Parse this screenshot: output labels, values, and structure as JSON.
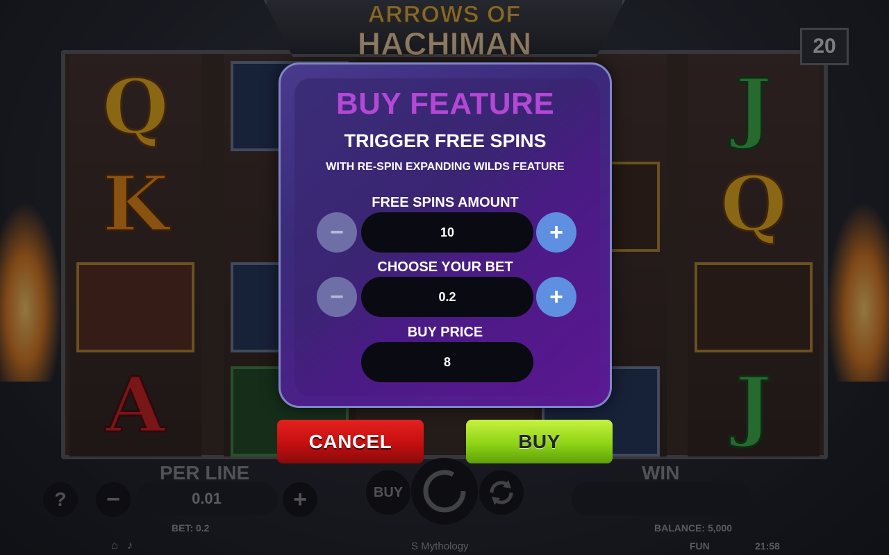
{
  "game": {
    "title_line1": "ARROWS OF",
    "title_line2": "HACHIMAN",
    "lines_count": "20"
  },
  "reels": {
    "col1": [
      "Q",
      "K",
      "",
      "A"
    ],
    "col5": [
      "J",
      "Q",
      "",
      "J"
    ]
  },
  "modal": {
    "title": "BUY FEATURE",
    "subtitle": "TRIGGER FREE SPINS",
    "subtitle2": "WITH RE-SPIN EXPANDING WILDS FEATURE",
    "free_spins_label": "FREE SPINS AMOUNT",
    "free_spins_value": "10",
    "bet_label": "CHOOSE YOUR BET",
    "bet_value": "0.2",
    "price_label": "BUY PRICE",
    "price_value": "8",
    "minus_symbol": "−",
    "plus_symbol": "+"
  },
  "actions": {
    "cancel_label": "CANCEL",
    "buy_label": "BUY"
  },
  "bottom": {
    "per_line_label": "PER LINE",
    "per_line_value": "0.01",
    "win_label": "WIN",
    "help_symbol": "?",
    "minus_symbol": "−",
    "plus_symbol": "+",
    "buy_small_label": "BUY",
    "bet_text": "BET: 0.2",
    "balance_text": "BALANCE: 5,000",
    "mode_text": "FUN",
    "clock_text": "21:58",
    "provider_text": "Mythology"
  },
  "colors": {
    "modal_title": "#b347d6",
    "plus_button": "#5e8fe0",
    "minus_button": "#6f6fa8",
    "cancel_button": "#d0181a",
    "buy_button": "#9ad81c"
  }
}
